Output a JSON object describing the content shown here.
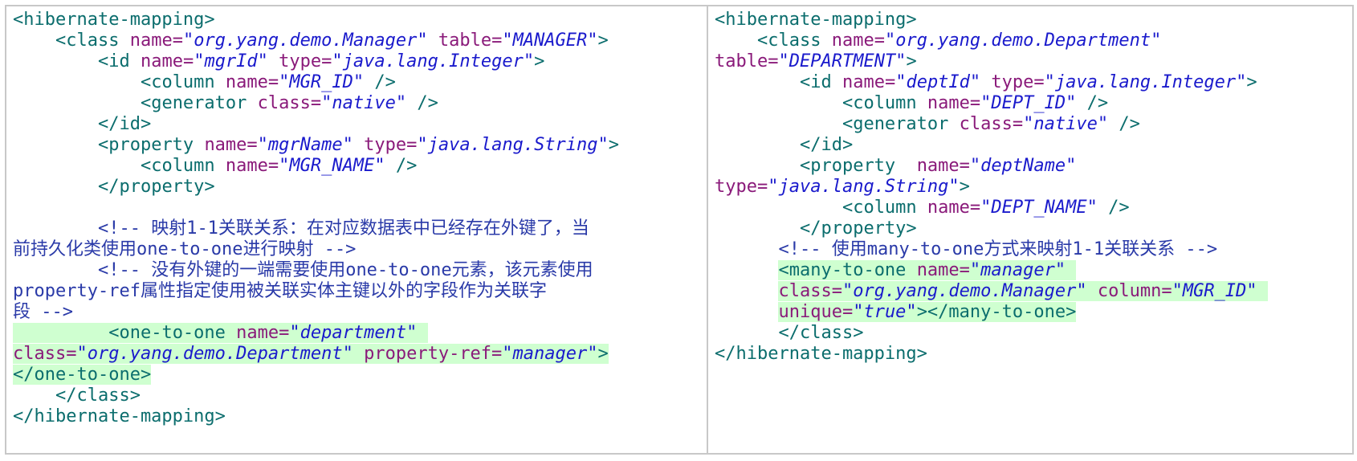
{
  "left_cell": {
    "open_mapping": "<hibernate-mapping>",
    "class_open": "<class",
    "class_name_attr": "name=",
    "class_name_val": "\"org.yang.demo.Manager\"",
    "class_table_attr": "table=",
    "class_table_val": "\"MANAGER\"",
    "gt": ">",
    "id_open": "<id",
    "id_name_attr": "name=",
    "id_name_val": "\"mgrId\"",
    "id_type_attr": "type=",
    "id_type_val": "\"java.lang.Integer\"",
    "col_open": "<column",
    "col_name_attr": "name=",
    "col_id_val": "\"MGR_ID\"",
    "selfclose": "/>",
    "gen_open": "<generator",
    "gen_class_attr": "class=",
    "gen_class_val": "\"native\"",
    "id_close": "</id>",
    "prop_open": "<property",
    "prop_name_attr": "name=",
    "prop_name_val": "\"mgrName\"",
    "prop_type_attr": "type=",
    "prop_type_val": "\"java.lang.String\"",
    "col_name_val2": "\"MGR_NAME\"",
    "prop_close": "</property>",
    "comment1_a": "<!-- 映射1-1关联关系：在对应数据表中已经存在外键了，当",
    "comment1_b": "前持久化类使用one-to-one进行映射 -->",
    "comment2_a": "<!-- 没有外键的一端需要使用one-to-one元素，该元素使用",
    "comment2_b": "property-ref属性指定使用被关联实体主键以外的字段作为关联字",
    "comment2_c": "段 -->",
    "oto_open": "<one-to-one",
    "oto_name_attr": "name=",
    "oto_name_val": "\"department\"",
    "oto_class_attr": "class=",
    "oto_class_val": "\"org.yang.demo.Department\"",
    "oto_ref_attr": "property-ref=",
    "oto_ref_val": "\"manager\"",
    "oto_close": "</one-to-one>",
    "class_close": "</class>",
    "close_mapping": "</hibernate-mapping>"
  },
  "right_cell": {
    "open_mapping": "<hibernate-mapping>",
    "class_open": "<class",
    "class_name_attr": "name=",
    "class_name_val": "\"org.yang.demo.Department\"",
    "class_table_attr": "table=",
    "class_table_val": "\"DEPARTMENT\"",
    "gt": ">",
    "id_open": "<id",
    "id_name_attr": "name=",
    "id_name_val": "\"deptId\"",
    "id_type_attr": "type=",
    "id_type_val": "\"java.lang.Integer\"",
    "col_open": "<column",
    "col_name_attr": "name=",
    "col_id_val": "\"DEPT_ID\"",
    "selfclose": "/>",
    "gen_open": "<generator",
    "gen_class_attr": "class=",
    "gen_class_val": "\"native\"",
    "id_close": "</id>",
    "prop_open": "<property",
    "prop_name_attr": "name=",
    "prop_name_val": "\"deptName\"",
    "prop_type_attr": "type=",
    "prop_type_val": "\"java.lang.String\"",
    "col_name_val2": "\"DEPT_NAME\"",
    "prop_close": "</property>",
    "comment1": "<!-- 使用many-to-one方式来映射1-1关联关系 -->",
    "mto_open": "<many-to-one",
    "mto_name_attr": "name=",
    "mto_name_val": "\"manager\"",
    "mto_class_attr": "class=",
    "mto_class_val": "\"org.yang.demo.Manager\"",
    "mto_col_attr": "column=",
    "mto_col_val": "\"MGR_ID\"",
    "mto_unique_attr": "unique=",
    "mto_unique_val": "\"true\"",
    "mto_close": "></many-to-one>",
    "class_close": "</class>",
    "close_mapping": "</hibernate-mapping>"
  }
}
